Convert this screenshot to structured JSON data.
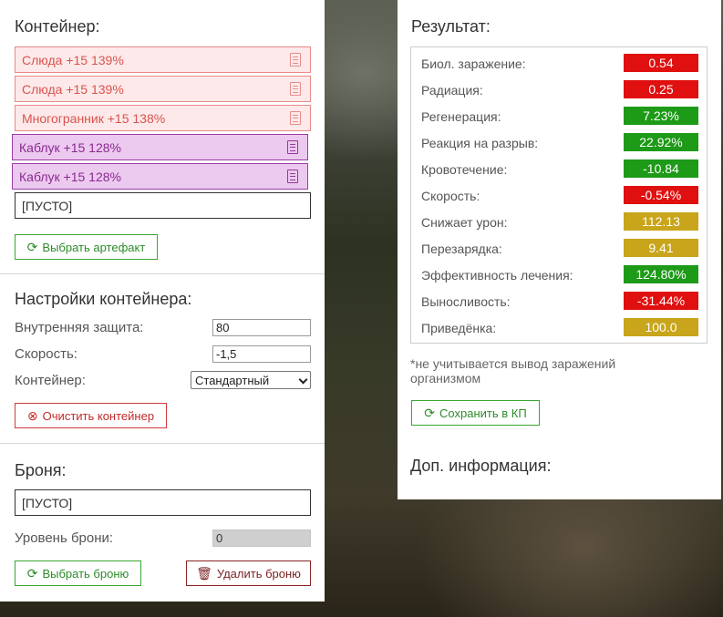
{
  "colors": {
    "red": "#e01010",
    "green": "#1d9a17",
    "yellow": "#c8a51a"
  },
  "container": {
    "title": "Контейнер:",
    "slots": [
      {
        "label": "Слюда +15 139%",
        "style": "pink",
        "icon": "document-icon"
      },
      {
        "label": "Слюда +15 139%",
        "style": "pink",
        "icon": "document-icon"
      },
      {
        "label": "Многогранник +15 138%",
        "style": "pink",
        "icon": "document-icon"
      },
      {
        "label": "Каблук +15 128%",
        "style": "purple",
        "icon": "document-icon"
      },
      {
        "label": "Каблук +15 128%",
        "style": "purple",
        "icon": "document-icon"
      },
      {
        "label": "[ПУСТО]",
        "style": "empty"
      }
    ],
    "select_artifact_button": "Выбрать артефакт"
  },
  "settings": {
    "title": "Настройки контейнера:",
    "inner_protection_label": "Внутренняя защита:",
    "inner_protection_value": "80",
    "speed_label": "Скорость:",
    "speed_value": "-1,5",
    "container_label": "Контейнер:",
    "container_value": "Стандартный",
    "clear_button": "Очистить контейнер"
  },
  "armor": {
    "title": "Броня:",
    "slot": "[ПУСТО]",
    "level_label": "Уровень брони:",
    "level_value": "0",
    "select_button": "Выбрать броню",
    "delete_button": "Удалить броню"
  },
  "result": {
    "title": "Результат:",
    "stats": [
      {
        "label": "Биол. заражение:",
        "value": "0.54",
        "color": "red"
      },
      {
        "label": "Радиация:",
        "value": "0.25",
        "color": "red"
      },
      {
        "label": "Регенерация:",
        "value": "7.23%",
        "color": "green"
      },
      {
        "label": "Реакция на разрыв:",
        "value": "22.92%",
        "color": "green"
      },
      {
        "label": "Кровотечение:",
        "value": "-10.84",
        "color": "green"
      },
      {
        "label": "Скорость:",
        "value": "-0.54%",
        "color": "red"
      },
      {
        "label": "Снижает урон:",
        "value": "112.13",
        "color": "yellow"
      },
      {
        "label": "Перезарядка:",
        "value": "9.41",
        "color": "yellow"
      },
      {
        "label": "Эффективность лечения:",
        "value": "124.80%",
        "color": "green"
      },
      {
        "label": "Выносливость:",
        "value": "-31.44%",
        "color": "red"
      },
      {
        "label": "Приведёнка:",
        "value": "100.0",
        "color": "yellow"
      }
    ],
    "note": "*не учитывается вывод заражений организмом",
    "save_button": "Сохранить в КП",
    "extra_title": "Доп. информация:"
  }
}
